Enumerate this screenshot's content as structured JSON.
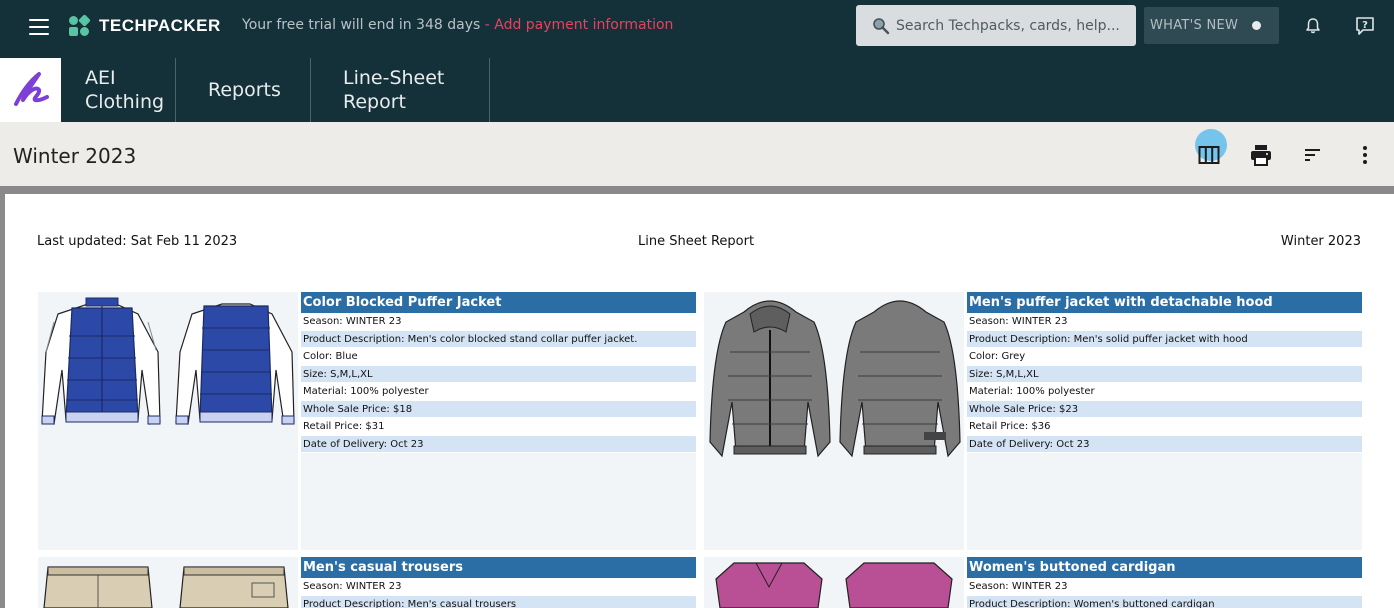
{
  "topbar": {
    "brand": "TECHPACKER",
    "trial_text": "Your free trial will end in 348 days",
    "trial_sep": " - ",
    "trial_link": "Add payment information",
    "search_placeholder": "Search Techpacks, cards, help...",
    "whats_new": "WHAT'S NEW"
  },
  "breadcrumbs": [
    {
      "label": "AEI Clothing"
    },
    {
      "label": "Reports"
    },
    {
      "label": "Line-Sheet Report"
    }
  ],
  "page": {
    "title": "Winter 2023"
  },
  "report": {
    "last_updated": "Last updated: Sat Feb 11 2023",
    "name": "Line Sheet Report",
    "season": "Winter 2023"
  },
  "products": [
    {
      "name": "Color Blocked Puffer Jacket",
      "fields": [
        {
          "k": "Season:",
          "v": "WINTER 23"
        },
        {
          "k": "Product Description:",
          "v": "Men's color blocked stand collar puffer jacket."
        },
        {
          "k": "Color:",
          "v": "Blue"
        },
        {
          "k": "Size:",
          "v": "S,M,L,XL"
        },
        {
          "k": "Material:",
          "v": "100% polyester"
        },
        {
          "k": "Whole Sale Price:",
          "v": "$18"
        },
        {
          "k": "Retail Price:",
          "v": "$31"
        },
        {
          "k": "Date of Delivery:",
          "v": "Oct 23"
        }
      ]
    },
    {
      "name": "Men's puffer jacket with detachable hood",
      "fields": [
        {
          "k": "Season:",
          "v": "WINTER 23"
        },
        {
          "k": "Product Description:",
          "v": "Men's solid puffer jacket with hood"
        },
        {
          "k": "Color:",
          "v": "Grey"
        },
        {
          "k": "Size:",
          "v": "S,M,L,XL"
        },
        {
          "k": "Material:",
          "v": "100% polyester"
        },
        {
          "k": "Whole Sale Price:",
          "v": "$23"
        },
        {
          "k": "Retail Price:",
          "v": "$36"
        },
        {
          "k": "Date of Delivery:",
          "v": "Oct 23"
        }
      ]
    },
    {
      "name": "Men's casual trousers",
      "fields": [
        {
          "k": "Season:",
          "v": "WINTER 23"
        },
        {
          "k": "Product Description:",
          "v": "Men's casual trousers"
        }
      ]
    },
    {
      "name": "Women's buttoned cardigan",
      "fields": [
        {
          "k": "Season:",
          "v": "WINTER 23"
        },
        {
          "k": "Product Description:",
          "v": "Women's buttoned cardigan"
        }
      ]
    }
  ],
  "colors": {
    "header_bg": "#143038",
    "brand_accent": "#59c4a3",
    "link_red": "#ef3f5c",
    "card_header": "#2b6ea6",
    "row_alt": "#d4e4f5",
    "title_bar": "#eeece8",
    "focus_ring": "#6ec2ec"
  },
  "icons": [
    "menu-icon",
    "techpacker-logo-icon",
    "search-icon",
    "status-dot-icon",
    "bell-icon",
    "help-icon",
    "columns-icon",
    "print-icon",
    "sort-icon",
    "more-vert-icon",
    "app-signature-icon"
  ]
}
